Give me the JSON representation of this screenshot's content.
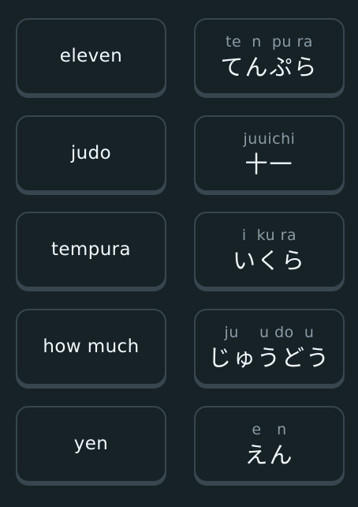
{
  "english_cards": [
    {
      "label": "eleven"
    },
    {
      "label": "judo"
    },
    {
      "label": "tempura"
    },
    {
      "label": "how much"
    },
    {
      "label": "yen"
    }
  ],
  "japanese_cards": [
    {
      "romaji": "te  n  pu ra",
      "kana": "てんぷら"
    },
    {
      "romaji": "juuichi",
      "kana": "十一"
    },
    {
      "romaji": "i  ku ra",
      "kana": "いくら"
    },
    {
      "romaji": "ju    u do  u",
      "kana": "じゅうどう"
    },
    {
      "romaji": "e   n",
      "kana": "えん"
    }
  ],
  "colors": {
    "background": "#172226",
    "card_border": "#38464f",
    "text": "#f1f7fb",
    "romaji_text": "#8c9ba4"
  }
}
